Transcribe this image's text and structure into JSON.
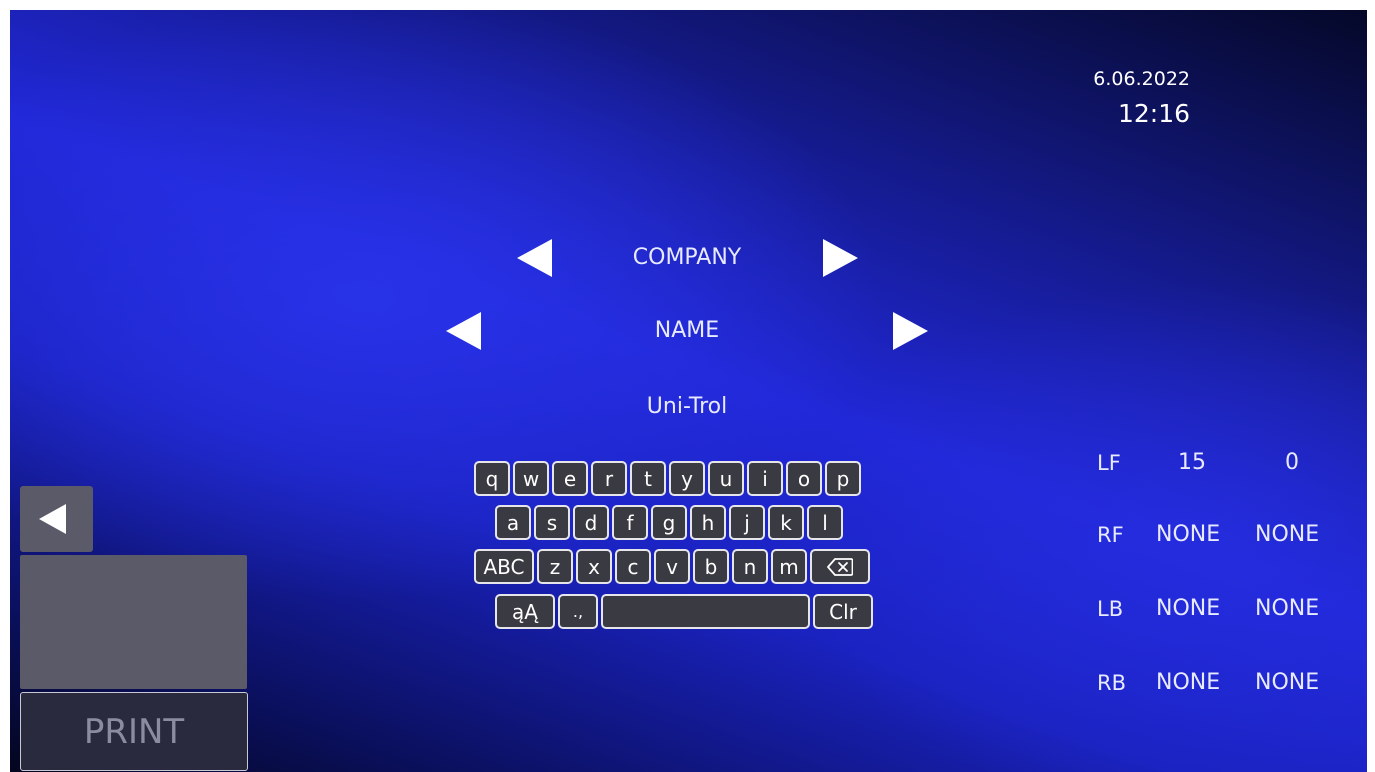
{
  "header": {
    "date": "6.06.2022",
    "time": "12:16"
  },
  "menu": {
    "category": "COMPANY",
    "field": "NAME",
    "value": "Uni-Trol"
  },
  "keyboard": {
    "row1": [
      "q",
      "w",
      "e",
      "r",
      "t",
      "y",
      "u",
      "i",
      "o",
      "p"
    ],
    "row2": [
      "a",
      "s",
      "d",
      "f",
      "g",
      "h",
      "j",
      "k",
      "l"
    ],
    "row3_shift": "ABC",
    "row3": [
      "z",
      "x",
      "c",
      "v",
      "b",
      "n",
      "m"
    ],
    "row4_accent": "ąĄ",
    "row4_punct": ".,",
    "row4_clear": "Clr",
    "backspace_icon": "backspace-icon",
    "space_icon": "spacebar"
  },
  "side_settings": [
    {
      "label": "LF",
      "v1": "15",
      "v2": "0"
    },
    {
      "label": "RF",
      "v1": "NONE",
      "v2": "NONE"
    },
    {
      "label": "LB",
      "v1": "NONE",
      "v2": "NONE"
    },
    {
      "label": "RB",
      "v1": "NONE",
      "v2": "NONE"
    }
  ],
  "controls": {
    "print_label": "PRINT",
    "back_icon": "back-arrow-icon"
  },
  "colors": {
    "key_bg": "#3a3a42",
    "key_border": "#e6e6ea",
    "panel_gray": "#5a5a68",
    "text": "#e8eaff"
  }
}
